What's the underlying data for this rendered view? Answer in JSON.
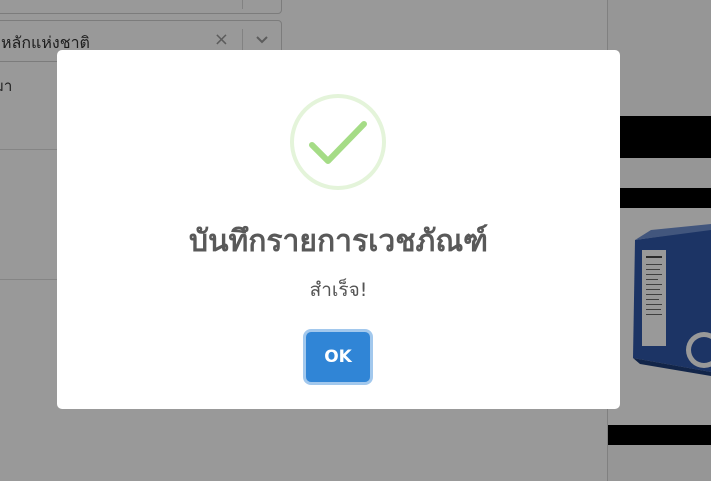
{
  "background": {
    "select_value": "หลักแห่งชาติ",
    "text_line": "มา"
  },
  "modal": {
    "icon": "success-check-icon",
    "title": "บันทึกรายการเวชภัณฑ์",
    "text": "สำเร็จ!",
    "confirm_label": "OK"
  },
  "colors": {
    "confirm_button": "#3085d6",
    "success_icon": "#a5dc86",
    "overlay": "rgba(0,0,0,0.4)"
  }
}
